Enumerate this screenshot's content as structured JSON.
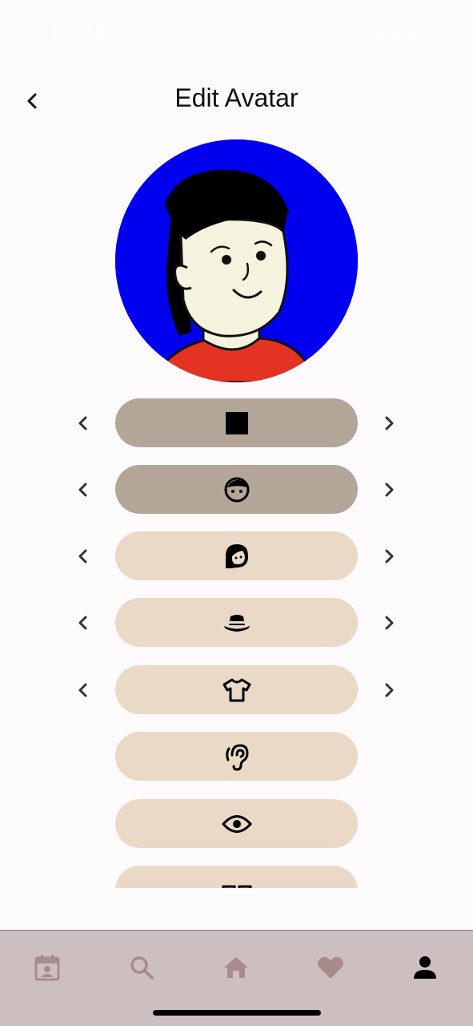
{
  "status": {
    "time": "10:16"
  },
  "header": {
    "title": "Edit Avatar"
  },
  "options": [
    {
      "icon": "square-icon",
      "selected": true,
      "has_arrows": true
    },
    {
      "icon": "face-icon",
      "selected": true,
      "has_arrows": true
    },
    {
      "icon": "hair-icon",
      "selected": false,
      "has_arrows": true
    },
    {
      "icon": "hat-icon",
      "selected": false,
      "has_arrows": true
    },
    {
      "icon": "shirt-icon",
      "selected": false,
      "has_arrows": true
    },
    {
      "icon": "ear-icon",
      "selected": false,
      "has_arrows": false
    },
    {
      "icon": "eye-icon",
      "selected": false,
      "has_arrows": false
    },
    {
      "icon": "partial-icon",
      "selected": false,
      "has_arrows": false
    }
  ],
  "tab_bar": {
    "tabs": [
      {
        "icon": "calendar-icon",
        "active": false
      },
      {
        "icon": "search-icon",
        "active": false
      },
      {
        "icon": "home-icon",
        "active": false
      },
      {
        "icon": "heart-icon",
        "active": false
      },
      {
        "icon": "person-icon",
        "active": true
      }
    ]
  },
  "colors": {
    "background": "#fdfafc",
    "avatar_bg": "#0000ee",
    "pill_active": "#b3a698",
    "pill_inactive": "#e9d9c6",
    "tab_bar": "#cdbfc0",
    "tab_inactive_icon": "#a88b8b",
    "tab_active_icon": "#000000",
    "skin": "#f3f3de",
    "shirt": "#e53323"
  }
}
